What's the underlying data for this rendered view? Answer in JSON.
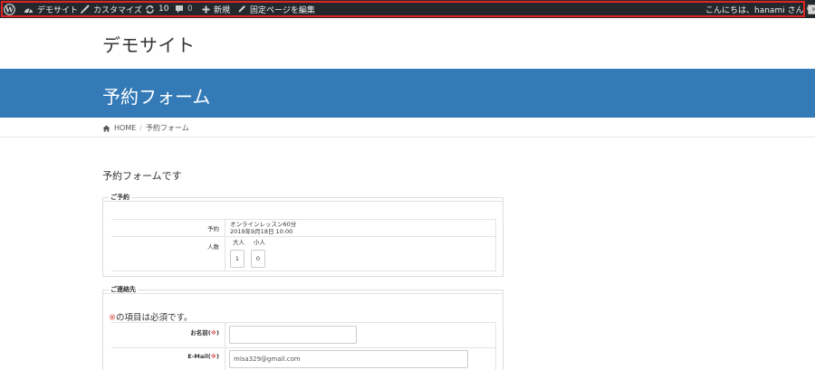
{
  "admin_bar": {
    "site_name": "デモサイト",
    "customize": "カスタマイズ",
    "updates_count": "10",
    "comments_count": "0",
    "new_label": "新規",
    "edit_page": "固定ページを編集",
    "greeting": "こんにちは、hanami さん"
  },
  "header": {
    "site_title": "デモサイト",
    "page_title": "予約フォーム"
  },
  "breadcrumb": {
    "home": "HOME",
    "separator": "/",
    "current": "予約フォーム"
  },
  "content": {
    "lead": "予約フォームです"
  },
  "reservation": {
    "legend": "ご予約",
    "reservation_label": "予約",
    "reservation_line1": "オンラインレッスン60分",
    "reservation_line2": "2019年9月18日 10:00",
    "people_label": "人数",
    "adult_label": "大人",
    "child_label": "小人",
    "adult_value": "1",
    "child_value": "0"
  },
  "contact": {
    "legend": "ご連絡先",
    "required_mark": "※",
    "required_note": "の項目は必須です。",
    "name_label": "お名前",
    "email_label": "E-Mail",
    "name_value": "",
    "email_value": "misa329@gmail.com"
  },
  "colors": {
    "admin_bar": "#23282d",
    "hero": "#337ab7",
    "required": "#d9534f",
    "highlight": "#e02424"
  }
}
